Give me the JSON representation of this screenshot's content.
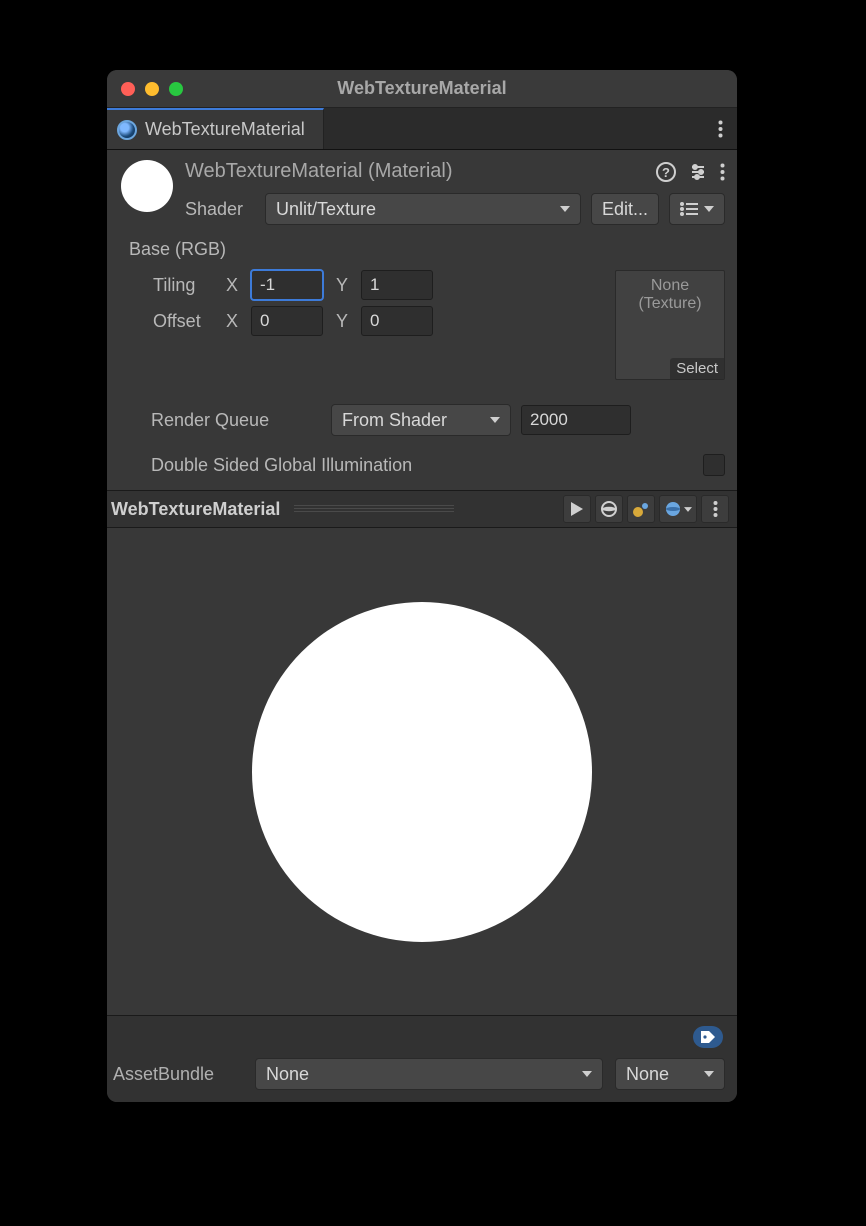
{
  "window": {
    "title": "WebTextureMaterial"
  },
  "tab": {
    "label": "WebTextureMaterial"
  },
  "header": {
    "title": "WebTextureMaterial (Material)",
    "shader_label": "Shader",
    "shader_value": "Unlit/Texture",
    "edit_label": "Edit..."
  },
  "props": {
    "base_label": "Base (RGB)",
    "tiling_label": "Tiling",
    "offset_label": "Offset",
    "x_label": "X",
    "y_label": "Y",
    "tiling_x": "-1",
    "tiling_y": "1",
    "offset_x": "0",
    "offset_y": "0",
    "tex_none": "None",
    "tex_type": "(Texture)",
    "tex_select": "Select",
    "render_queue_label": "Render Queue",
    "render_queue_mode": "From Shader",
    "render_queue_value": "2000",
    "dsgi_label": "Double Sided Global Illumination"
  },
  "preview": {
    "name": "WebTextureMaterial"
  },
  "footer": {
    "assetbundle_label": "AssetBundle",
    "assetbundle_value": "None",
    "variant_value": "None"
  }
}
